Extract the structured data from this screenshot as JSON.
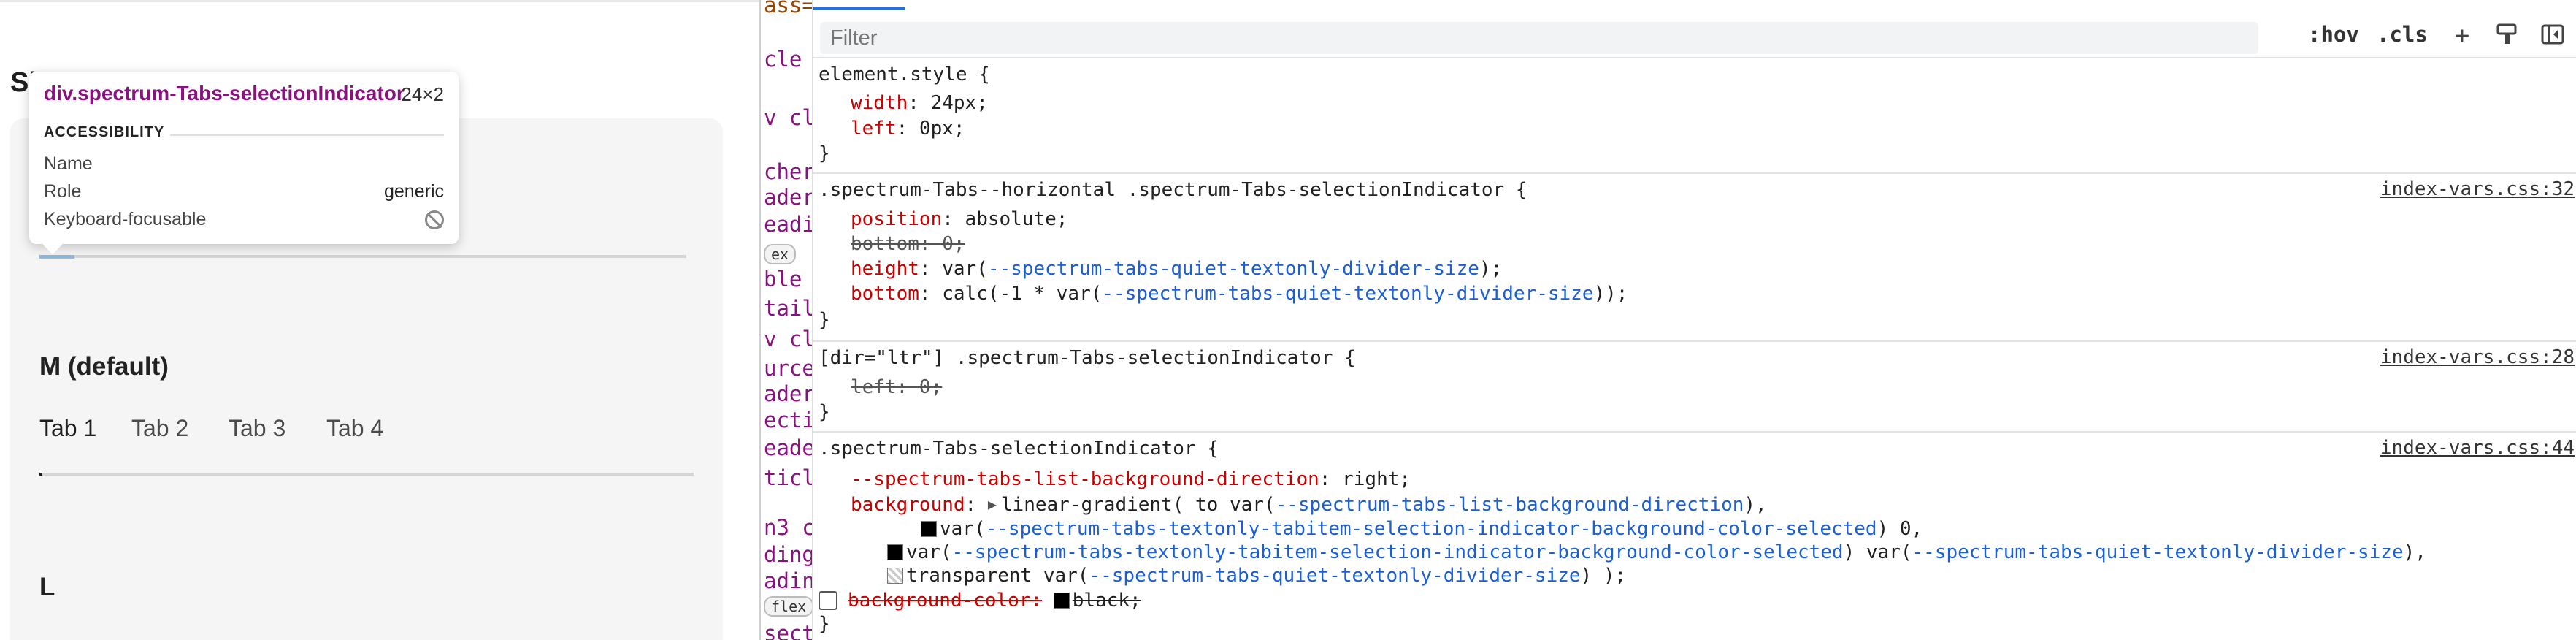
{
  "preview": {
    "partial_heading": "Si",
    "medium_heading": "M (default)",
    "large_heading": "L",
    "tabs": [
      "Tab 1",
      "Tab 2",
      "Tab 3",
      "Tab 4"
    ],
    "active_tab": "Tab 1"
  },
  "tooltip": {
    "title": "div.spectrum-Tabs-selectionIndicator",
    "size": "24×2",
    "section": "ACCESSIBILITY",
    "rows": [
      {
        "label": "Name",
        "value": ""
      },
      {
        "label": "Role",
        "value": "generic"
      },
      {
        "label": "Keyboard-focusable",
        "value": ""
      }
    ]
  },
  "dom_fragments": [
    {
      "text": "ass=",
      "kind": "attr"
    },
    {
      "text": "cle",
      "kind": "tag"
    },
    {
      "text": "v cl",
      "kind": "tag"
    },
    {
      "text": "cher",
      "kind": "tag"
    },
    {
      "text": "ader",
      "kind": "tag"
    },
    {
      "text": "eadi",
      "kind": "tag"
    },
    {
      "text": "ex",
      "kind": "badge"
    },
    {
      "text": "ble",
      "kind": "tag"
    },
    {
      "text": "tail",
      "kind": "tag"
    },
    {
      "text": "v cl",
      "kind": "tag"
    },
    {
      "text": "urce",
      "kind": "tag"
    },
    {
      "text": "ader",
      "kind": "tag"
    },
    {
      "text": "ecti",
      "kind": "tag"
    },
    {
      "text": "eade",
      "kind": "tag"
    },
    {
      "text": "ticl",
      "kind": "tag"
    },
    {
      "text": "n3 c",
      "kind": "tag"
    },
    {
      "text": "ding",
      "kind": "tag"
    },
    {
      "text": "adin",
      "kind": "tag"
    },
    {
      "text": "flex",
      "kind": "badge"
    },
    {
      "text": "sect",
      "kind": "tag"
    }
  ],
  "styles": {
    "filter_placeholder": "Filter",
    "hov_label": ":hov",
    "cls_label": ".cls",
    "plus_label": "+",
    "element_style": {
      "selector": "element.style {",
      "props": [
        {
          "name": "width",
          "value": "24px;"
        },
        {
          "name": "left",
          "value": "0px;"
        }
      ]
    },
    "rule1": {
      "selector": ".spectrum-Tabs--horizontal .spectrum-Tabs-selectionIndicator {",
      "source": "index-vars.css:32",
      "l1n": "position",
      "l1v": "absolute;",
      "l2": "bottom: 0;",
      "l3n": "height",
      "l3a": "var(",
      "l3v": "--spectrum-tabs-quiet-textonly-divider-size",
      "l3b": ");",
      "l4n": "bottom",
      "l4a": "calc(-1 * var(",
      "l4v": "--spectrum-tabs-quiet-textonly-divider-size",
      "l4b": "));"
    },
    "rule2": {
      "selector": "[dir=\"ltr\"] .spectrum-Tabs-selectionIndicator {",
      "source": "index-vars.css:28",
      "l1": "left: 0;"
    },
    "rule3": {
      "selector": ".spectrum-Tabs-selectionIndicator {",
      "source": "index-vars.css:44",
      "l1n": "--spectrum-tabs-list-background-direction",
      "l1v": "right;",
      "l2n": "background",
      "l2a": "linear-gradient( to var(",
      "l2v": "--spectrum-tabs-list-background-direction",
      "l2b": "),",
      "l3a": "var(",
      "l3v": "--spectrum-tabs-textonly-tabitem-selection-indicator-background-color-selected",
      "l3b": ") 0,",
      "l4a": "var(",
      "l4v": "--spectrum-tabs-textonly-tabitem-selection-indicator-background-color-selected",
      "l4b": ") var(",
      "l4v2": "--spectrum-tabs-quiet-textonly-divider-size",
      "l4c": "),",
      "l5a": "transparent var(",
      "l5v": "--spectrum-tabs-quiet-textonly-divider-size",
      "l5b": ") );",
      "l6": "background-color:",
      "l6v": "black;"
    },
    "closing_brace": "}"
  }
}
